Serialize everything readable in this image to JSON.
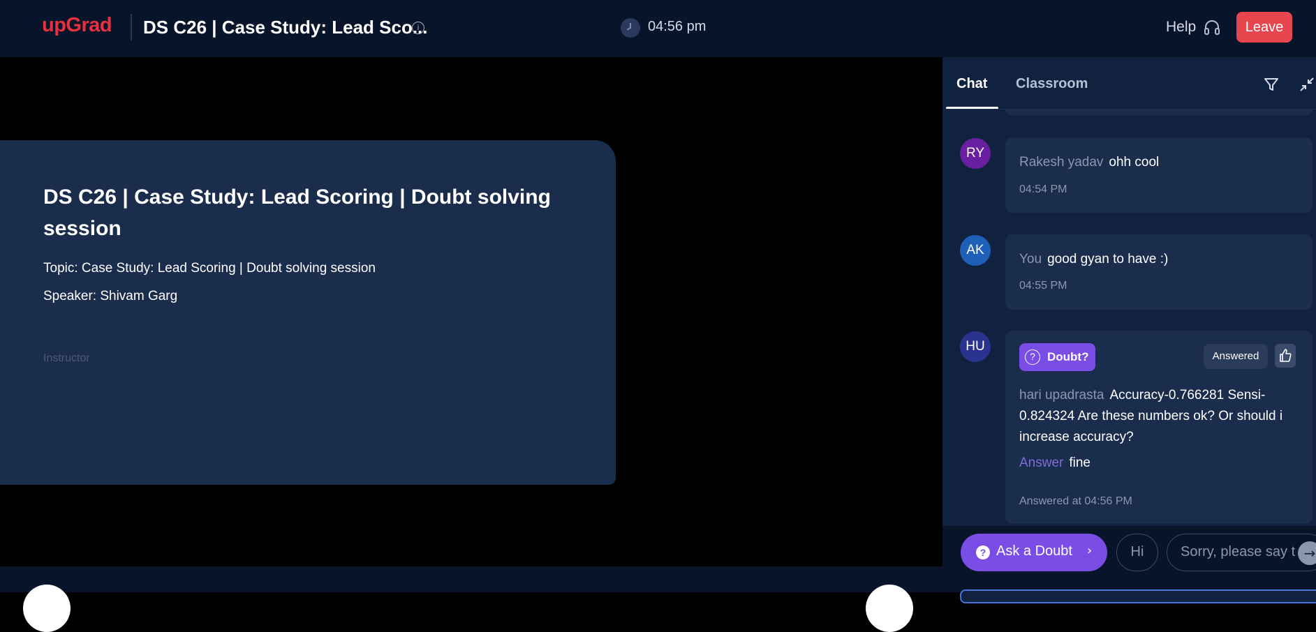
{
  "header": {
    "logo": "upGrad",
    "session_title": "DS C26 | Case Study: Lead Sco...",
    "info_icon": "i",
    "clock_time": "04:56 pm",
    "help_label": "Help",
    "leave_label": "Leave"
  },
  "card": {
    "title": "DS C26 | Case Study: Lead Scoring | Doubt solving session",
    "topic": "Topic: Case Study: Lead Scoring | Doubt solving session",
    "speaker": "Speaker: Shivam Garg",
    "role": "Instructor"
  },
  "chat": {
    "tabs": [
      {
        "label": "Chat",
        "active": true
      },
      {
        "label": "Classroom",
        "active": false
      }
    ],
    "messages": [
      {
        "initials": "RY",
        "avatar_color": "#6a1fa0",
        "author": "Rakesh yadav",
        "text": "ohh cool",
        "time": "04:54 PM"
      },
      {
        "initials": "AK",
        "avatar_color": "#1e5fb8",
        "author": "You",
        "text": "good gyan to have :)",
        "time": "04:55 PM"
      }
    ],
    "doubt": {
      "initials": "HU",
      "avatar_color": "#2a3390",
      "tag_icon": "?",
      "tag_label": "Doubt?",
      "status": "Answered",
      "author": "hari upadrasta",
      "text": "Accuracy-0.766281 Sensi-0.824324 Are these numbers ok? Or should i increase accuracy?",
      "answer_label": "Answer",
      "answer_text": "fine",
      "answered_at": "Answered at 04:56 PM"
    },
    "footer": {
      "ask_icon": "?",
      "ask_label": "Ask a Doubt",
      "ask_chevron": "›",
      "quick_replies": [
        "Hi",
        "Sorry, please say t"
      ],
      "send_icon": "→"
    }
  },
  "colors": {
    "brand": "#e8313f",
    "leave": "#e8464f",
    "header_bg": "#08142a",
    "card_bg": "#1b2d4d",
    "chat_bg": "#102240",
    "doubt_accent": "#7a4de6"
  }
}
